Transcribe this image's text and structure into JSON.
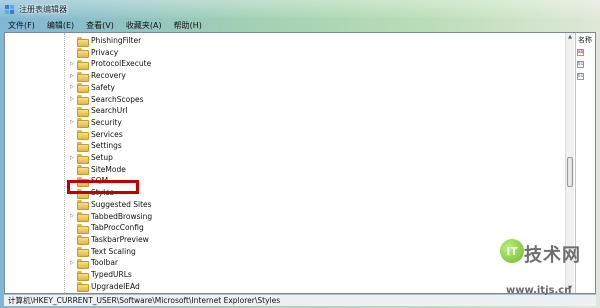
{
  "window": {
    "title": "注册表编辑器"
  },
  "menu": [
    {
      "label": "文件(F)"
    },
    {
      "label": "编辑(E)"
    },
    {
      "label": "查看(V)"
    },
    {
      "label": "收藏夹(A)"
    },
    {
      "label": "帮助(H)"
    }
  ],
  "tree": {
    "items": [
      {
        "label": "PhishingFilter",
        "expandable": false
      },
      {
        "label": "Privacy",
        "expandable": false
      },
      {
        "label": "ProtocolExecute",
        "expandable": true
      },
      {
        "label": "Recovery",
        "expandable": true
      },
      {
        "label": "Safety",
        "expandable": true
      },
      {
        "label": "SearchScopes",
        "expandable": true
      },
      {
        "label": "SearchUrl",
        "expandable": false
      },
      {
        "label": "Security",
        "expandable": true
      },
      {
        "label": "Services",
        "expandable": false
      },
      {
        "label": "Settings",
        "expandable": false
      },
      {
        "label": "Setup",
        "expandable": true
      },
      {
        "label": "SiteMode",
        "expandable": false
      },
      {
        "label": "SQM",
        "expandable": false
      },
      {
        "label": "Styles",
        "expandable": true,
        "selected": true
      },
      {
        "label": "Suggested Sites",
        "expandable": false
      },
      {
        "label": "TabbedBrowsing",
        "expandable": true
      },
      {
        "label": "TabProcConfig",
        "expandable": false
      },
      {
        "label": "TaskbarPreview",
        "expandable": false
      },
      {
        "label": "Text Scaling",
        "expandable": false
      },
      {
        "label": "Toolbar",
        "expandable": true
      },
      {
        "label": "TypedURLs",
        "expandable": false
      },
      {
        "label": "UpgradeIEAd",
        "expandable": false
      }
    ]
  },
  "right_pane": {
    "header": "名称",
    "values": [
      {
        "icon": "string-value-icon",
        "glyph": "ab"
      },
      {
        "icon": "binary-value-icon",
        "glyph": "01"
      },
      {
        "icon": "binary-value-icon",
        "glyph": "01"
      }
    ]
  },
  "status": {
    "path": "计算机\\HKEY_CURRENT_USER\\Software\\Microsoft\\Internet Explorer\\Styles"
  },
  "watermark": {
    "logo_text": "IT",
    "brand": "技术网",
    "url": "www.itjs.cn"
  },
  "colors": {
    "highlight_box": "#c00000",
    "folder": "#e3b548"
  }
}
